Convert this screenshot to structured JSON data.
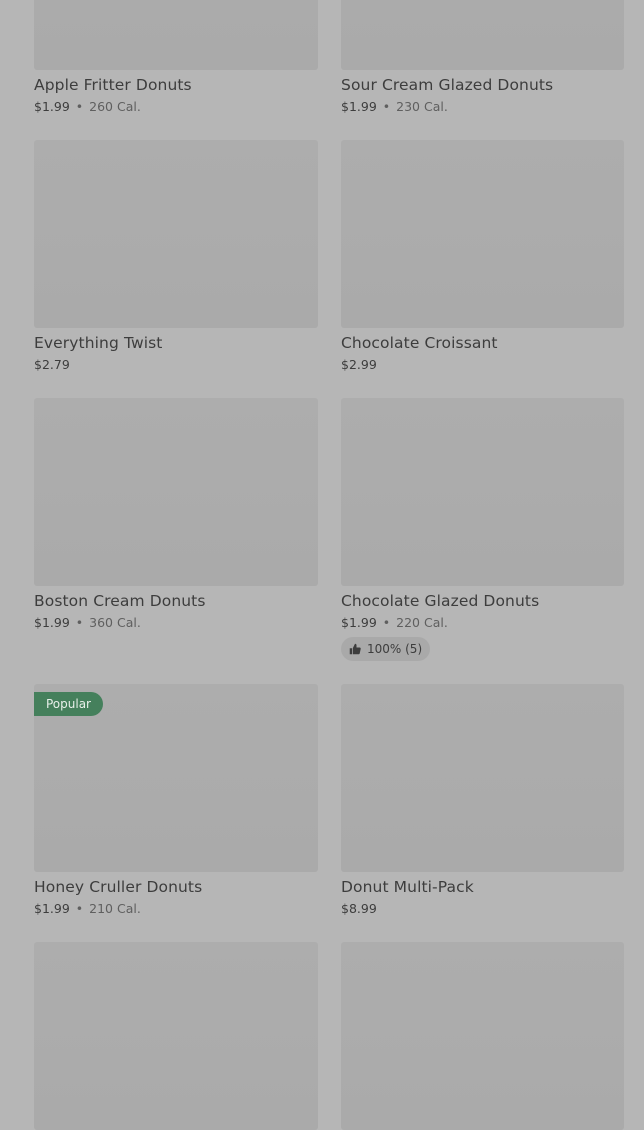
{
  "items": [
    {
      "name": "Apple Fritter Donuts",
      "price": "$1.99",
      "sep": "•",
      "calories": "260 Cal."
    },
    {
      "name": "Sour Cream Glazed Donuts",
      "price": "$1.99",
      "sep": "•",
      "calories": "230 Cal."
    },
    {
      "name": "Everything Twist",
      "price": "$2.79"
    },
    {
      "name": "Chocolate Croissant",
      "price": "$2.99"
    },
    {
      "name": "Boston Cream Donuts",
      "price": "$1.99",
      "sep": "•",
      "calories": "360 Cal."
    },
    {
      "name": "Chocolate Glazed Donuts",
      "price": "$1.99",
      "sep": "•",
      "calories": "220 Cal.",
      "rating": "100% (5)"
    },
    {
      "name": "Honey Cruller Donuts",
      "price": "$1.99",
      "sep": "•",
      "calories": "210 Cal.",
      "badge": "Popular"
    },
    {
      "name": "Donut Multi-Pack",
      "price": "$8.99"
    }
  ],
  "icons": {
    "rating_icon": "thumbs-up-icon"
  },
  "colors": {
    "badge_bg": "#45805c",
    "overlay": "#b6b6b6"
  }
}
